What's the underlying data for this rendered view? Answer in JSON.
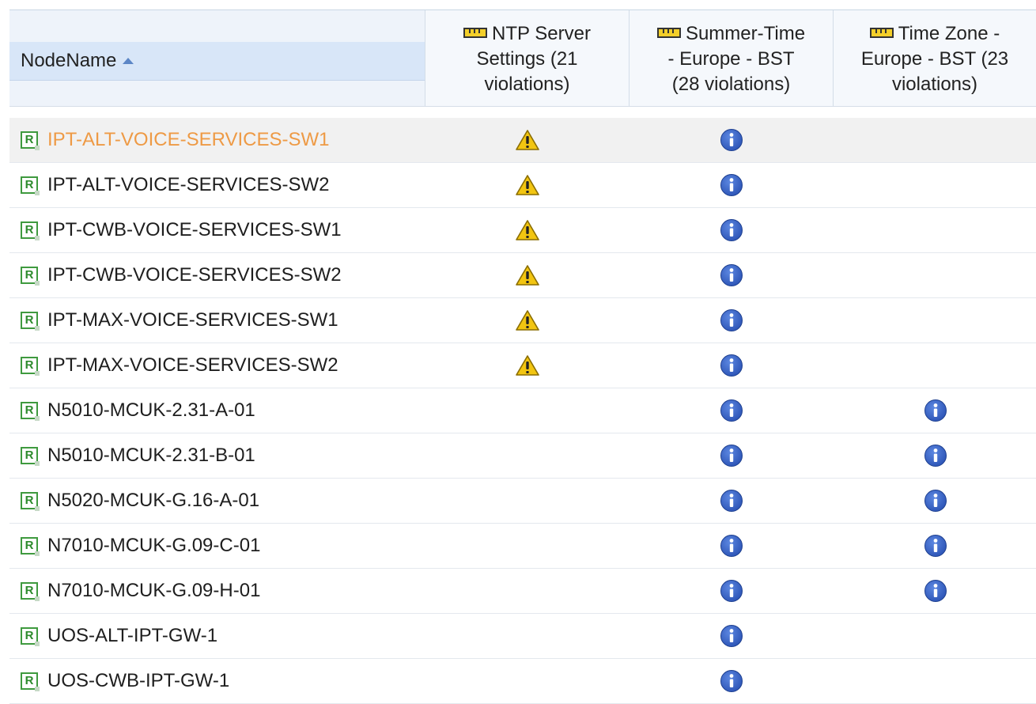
{
  "columns": {
    "node": "NodeName",
    "ntp": "NTP Server Settings (21 violations)",
    "summer": "Summer-Time - Europe - BST (28 violations)",
    "timezone": "Time Zone - Europe - BST (23 violations)"
  },
  "header_lines": {
    "ntp": [
      "NTP Server",
      "Settings (21",
      "violations)"
    ],
    "summer": [
      "Summer-Time",
      "- Europe - BST",
      "(28 violations)"
    ],
    "timezone": [
      "Time Zone -",
      "Europe - BST (23",
      "violations)"
    ]
  },
  "sort": {
    "column": "NodeName",
    "direction": "ascending"
  },
  "icons": {
    "header": "ruler-icon",
    "node": "router-r-icon",
    "warning": "warning-icon",
    "info": "info-icon"
  },
  "colors": {
    "selected_text": "#ee9a45",
    "info": "#2f57b8",
    "warning": "#f2c511"
  },
  "rows": [
    {
      "name": "IPT-ALT-VOICE-SERVICES-SW1",
      "selected": true,
      "ntp": "warning",
      "summer": "info",
      "timezone": ""
    },
    {
      "name": "IPT-ALT-VOICE-SERVICES-SW2",
      "selected": false,
      "ntp": "warning",
      "summer": "info",
      "timezone": ""
    },
    {
      "name": "IPT-CWB-VOICE-SERVICES-SW1",
      "selected": false,
      "ntp": "warning",
      "summer": "info",
      "timezone": ""
    },
    {
      "name": "IPT-CWB-VOICE-SERVICES-SW2",
      "selected": false,
      "ntp": "warning",
      "summer": "info",
      "timezone": ""
    },
    {
      "name": "IPT-MAX-VOICE-SERVICES-SW1",
      "selected": false,
      "ntp": "warning",
      "summer": "info",
      "timezone": ""
    },
    {
      "name": "IPT-MAX-VOICE-SERVICES-SW2",
      "selected": false,
      "ntp": "warning",
      "summer": "info",
      "timezone": ""
    },
    {
      "name": "N5010-MCUK-2.31-A-01",
      "selected": false,
      "ntp": "",
      "summer": "info",
      "timezone": "info"
    },
    {
      "name": "N5010-MCUK-2.31-B-01",
      "selected": false,
      "ntp": "",
      "summer": "info",
      "timezone": "info"
    },
    {
      "name": "N5020-MCUK-G.16-A-01",
      "selected": false,
      "ntp": "",
      "summer": "info",
      "timezone": "info"
    },
    {
      "name": "N7010-MCUK-G.09-C-01",
      "selected": false,
      "ntp": "",
      "summer": "info",
      "timezone": "info"
    },
    {
      "name": "N7010-MCUK-G.09-H-01",
      "selected": false,
      "ntp": "",
      "summer": "info",
      "timezone": "info"
    },
    {
      "name": "UOS-ALT-IPT-GW-1",
      "selected": false,
      "ntp": "",
      "summer": "info",
      "timezone": ""
    },
    {
      "name": "UOS-CWB-IPT-GW-1",
      "selected": false,
      "ntp": "",
      "summer": "info",
      "timezone": ""
    }
  ]
}
